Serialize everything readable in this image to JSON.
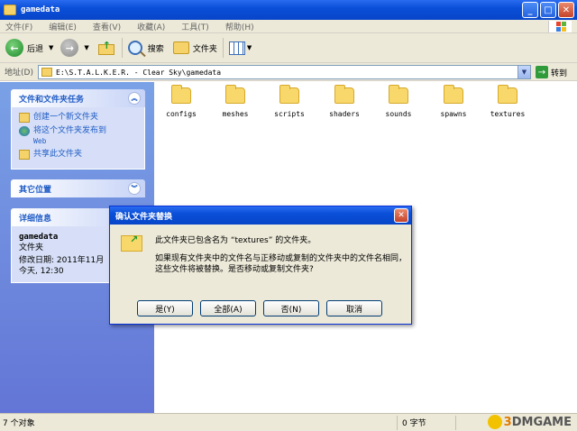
{
  "window": {
    "title": "gamedata"
  },
  "menu": [
    "文件(F)",
    "编辑(E)",
    "查看(V)",
    "收藏(A)",
    "工具(T)",
    "帮助(H)"
  ],
  "toolbar": {
    "back": "后退",
    "search": "搜索",
    "folders": "文件夹"
  },
  "address": {
    "label": "地址(D)",
    "path": "E:\\S.T.A.L.K.E.R. - Clear Sky\\gamedata",
    "go": "转到"
  },
  "tasks_panel": {
    "title": "文件和文件夹任务",
    "items": [
      {
        "label": "创建一个新文件夹",
        "sub": ""
      },
      {
        "label": "将这个文件夹发布到",
        "sub": "Web"
      },
      {
        "label": "共享此文件夹",
        "sub": ""
      }
    ]
  },
  "other_panel": {
    "title": "其它位置"
  },
  "details_panel": {
    "title": "详细信息",
    "name": "gamedata",
    "type": "文件夹",
    "modified": "修改日期: 2011年11月",
    "time": "今天, 12:30"
  },
  "folders": [
    "configs",
    "meshes",
    "scripts",
    "shaders",
    "sounds",
    "spawns",
    "textures"
  ],
  "dialog": {
    "title": "确认文件夹替换",
    "line1": "此文件夹已包含名为 “textures” 的文件夹。",
    "line2": "如果现有文件夹中的文件名与正移动或复制的文件夹中的文件名相同，这些文件将被替换。是否移动或复制文件夹?",
    "buttons": [
      "是(Y)",
      "全部(A)",
      "否(N)",
      "取消"
    ]
  },
  "status": {
    "objects": "7 个对象",
    "size": "0 字节"
  },
  "watermark": {
    "num": "3",
    "text": "DMGAME"
  }
}
